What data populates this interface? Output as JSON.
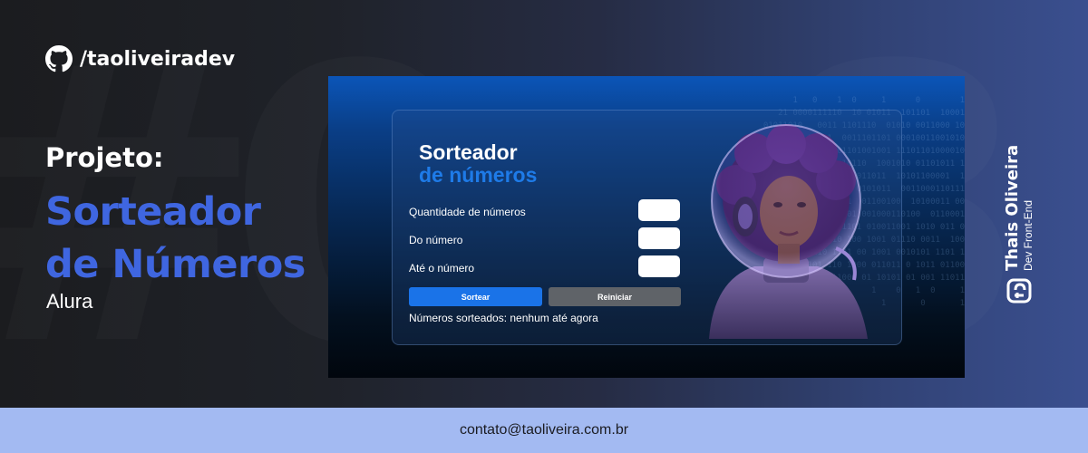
{
  "profile": {
    "github_handle": "/taoliveiradev",
    "github_icon": "github-icon"
  },
  "hero": {
    "label": "Projeto:",
    "title_line1": "Sorteador",
    "title_line2": "de Números",
    "subtitle": "Alura",
    "accent_color": "#3f66e0"
  },
  "app_screenshot": {
    "title_line1": "Sorteador",
    "title_line2": "de números",
    "fields": [
      {
        "label": "Quantidade de números",
        "value": ""
      },
      {
        "label": "Do número",
        "value": ""
      },
      {
        "label": "Até o número",
        "value": ""
      }
    ],
    "draw_button": "Sortear",
    "reset_button": "Reiniciar",
    "result_text": "Números sorteados: nenhum até agora",
    "primary_color": "#1a73e8",
    "secondary_color": "#5f6368"
  },
  "signature": {
    "name": "Thais Oliveira",
    "role": "Dev Front-End",
    "logo_icon": "to-monogram-logo"
  },
  "footer": {
    "contact": "contato@taoliveira.com.br",
    "background_color": "#a3baf2"
  }
}
